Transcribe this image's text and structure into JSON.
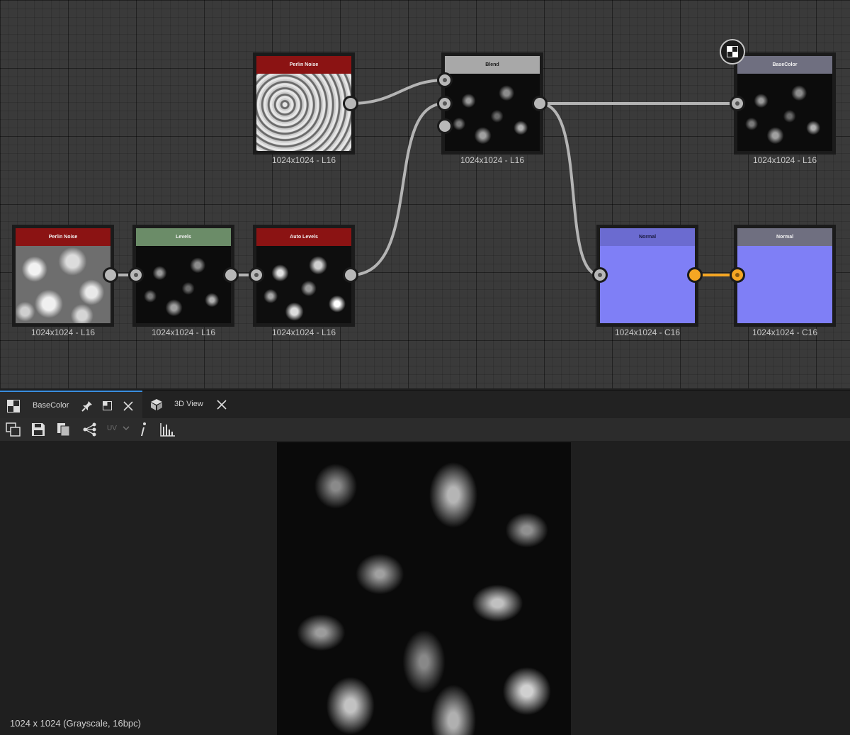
{
  "nodes": {
    "perlin_top": {
      "title": "Perlin Noise",
      "size": "1024x1024 - L16",
      "header_color": "#8b1313"
    },
    "blend": {
      "title": "Blend",
      "size": "1024x1024 - L16",
      "header_color": "#a8a8a8"
    },
    "basecolor_out": {
      "title": "BaseColor",
      "size": "1024x1024 - L16",
      "header_color": "#6f6f80"
    },
    "perlin_bottom": {
      "title": "Perlin Noise",
      "size": "1024x1024 - L16",
      "header_color": "#8b1313"
    },
    "levels": {
      "title": "Levels",
      "size": "1024x1024 - L16",
      "header_color": "#6b8c68"
    },
    "auto_levels": {
      "title": "Auto Levels",
      "size": "1024x1024 - L16",
      "header_color": "#8b1313"
    },
    "normal": {
      "title": "Normal",
      "size": "1024x1024 - C16",
      "header_color": "#6b6bd0"
    },
    "normal_out": {
      "title": "Normal",
      "size": "1024x1024 - C16",
      "header_color": "#6f6f80"
    }
  },
  "colors": {
    "wire": "#b4b4b4",
    "wire_active": "#f5a623",
    "tab_accent": "#3b8fe0"
  },
  "viewer": {
    "tabs": [
      {
        "label": "BaseColor",
        "icon": "checker-icon"
      },
      {
        "label": "3D View",
        "icon": "cube-icon"
      }
    ],
    "toolbar": {
      "uv_label": "UV"
    },
    "status": "1024 x 1024 (Grayscale, 16bpc)"
  }
}
